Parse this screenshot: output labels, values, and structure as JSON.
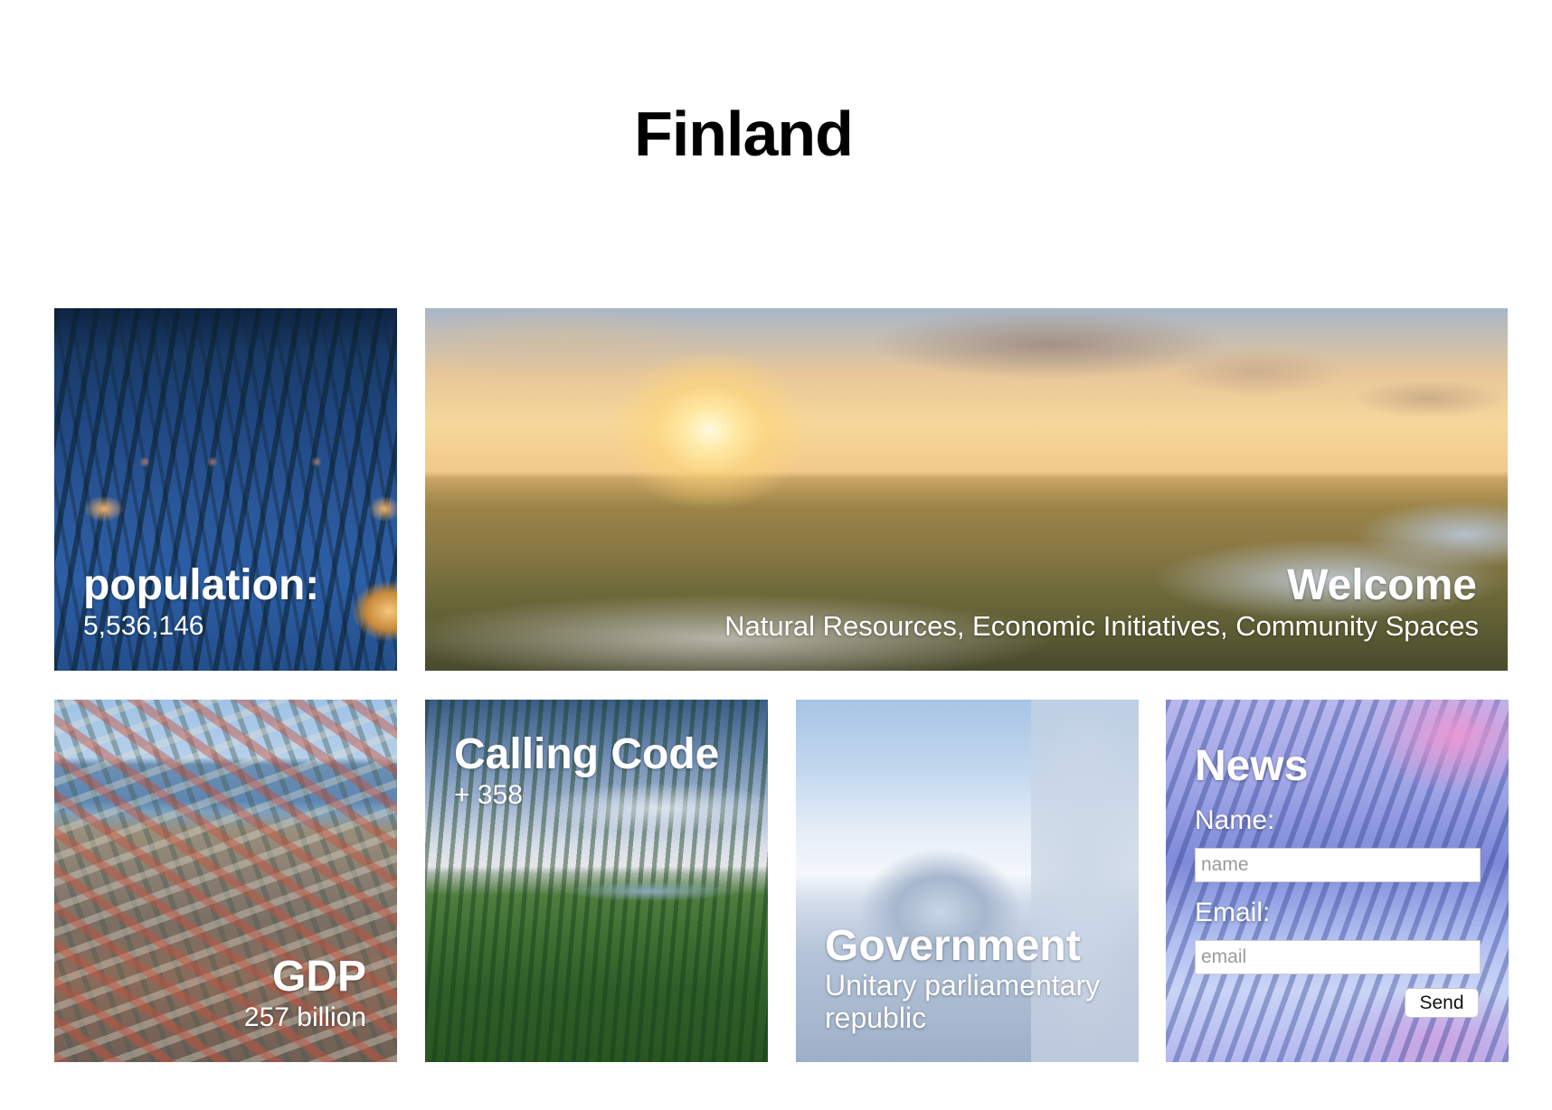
{
  "page": {
    "title": "Finland"
  },
  "tiles": {
    "population": {
      "title": "population:",
      "value": "5,536,146",
      "scene": "snowy night forest with glass igloos"
    },
    "welcome": {
      "title": "Welcome",
      "subtitle": "Natural Resources, Economic Initiatives, Community Spaces",
      "scene": "sunset over lakes and forest"
    },
    "gdp": {
      "title": "GDP",
      "value": "257 billion",
      "scene": "aerial view of a coastal city"
    },
    "calling_code": {
      "title": "Calling Code",
      "value": "+ 358",
      "scene": "forest and lake under a cloudy sky"
    },
    "government": {
      "title": "Government",
      "value": "Unitary parliamentary republic",
      "scene": "ice hotel under a bright sky"
    },
    "news": {
      "title": "News",
      "name_label": "Name:",
      "name_placeholder": "name",
      "email_label": "Email:",
      "email_placeholder": "email",
      "send_label": "Send",
      "scene": "snowy forest under a pink sky"
    }
  }
}
